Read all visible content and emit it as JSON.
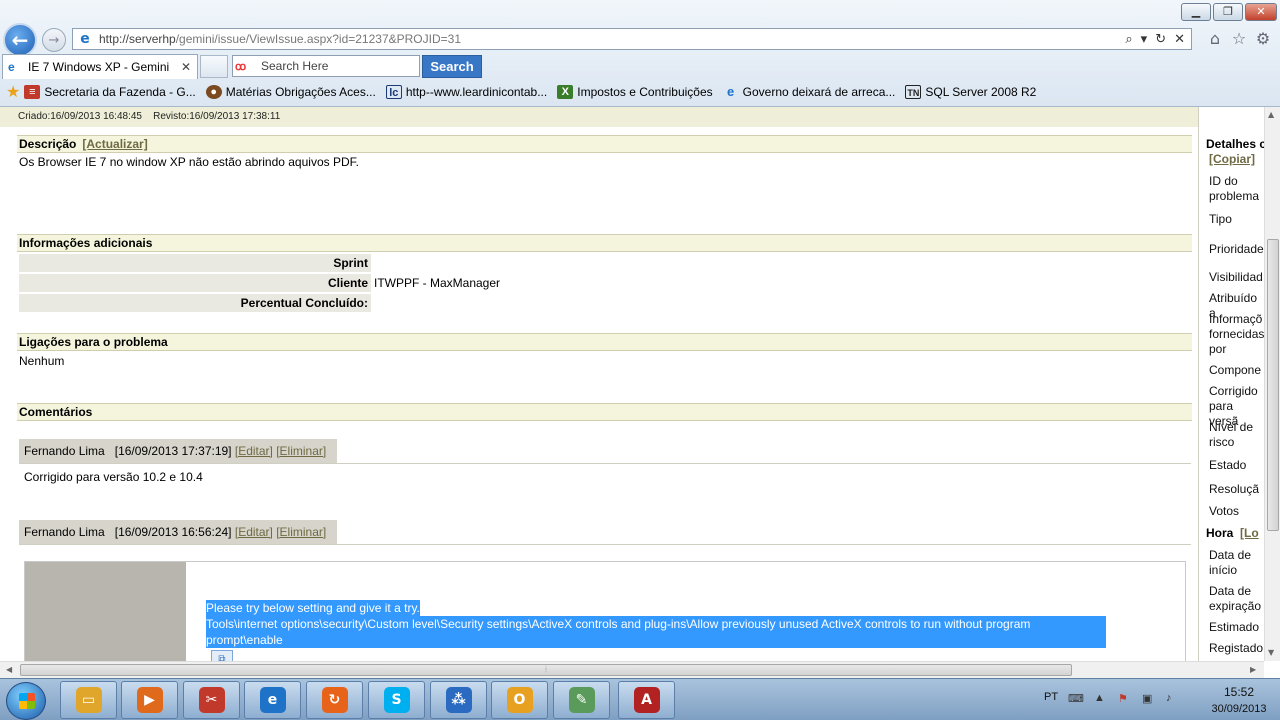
{
  "browser": {
    "url": "http://serverhp/gemini/issue/ViewIssue.aspx?id=21237&PROJID=31",
    "url_host": "http://serverhp",
    "url_path": "/gemini/issue/ViewIssue.aspx?id=21237&PROJID=31",
    "tab_title": "IE 7 Windows XP - Gemini",
    "search_placeholder": "Search Here",
    "search_button": "Search",
    "favorites": [
      {
        "label": "Secretaria da Fazenda - G...",
        "icon": "flag-icon",
        "color": "#c0392b"
      },
      {
        "label": "Matérias Obrigações Aces...",
        "icon": "globe-icon",
        "color": "#7b4a20"
      },
      {
        "label": "http--www.leardinicontab...",
        "icon": "lc-icon",
        "color": "#1a3b78"
      },
      {
        "label": "Impostos e Contribuições",
        "icon": "x-icon",
        "color": "#3a7d2b"
      },
      {
        "label": "Governo deixará de arreca...",
        "icon": "ie-icon",
        "color": "#1e73c8"
      },
      {
        "label": "SQL Server 2008 R2",
        "icon": "tn-icon",
        "color": "#222222"
      }
    ]
  },
  "issue": {
    "created": "Criado:16/09/2013 16:48:45",
    "revised": "Revisto:16/09/2013 17:38:11",
    "description_header": "Descrição",
    "update_link": "[Actualizar]",
    "description_text": "Os Browser IE 7 no window XP não estão abrindo aquivos PDF.",
    "additional_header": "Informações adicionais",
    "fields": [
      {
        "label": "Sprint",
        "value": ""
      },
      {
        "label": "Cliente",
        "value": "ITWPPF - MaxManager"
      },
      {
        "label": "Percentual Concluído:",
        "value": ""
      }
    ],
    "links_header": "Ligações para o problema",
    "links_value": "Nenhum",
    "comments_header": "Comentários",
    "comments": [
      {
        "author": "Fernando Lima",
        "date": "[16/09/2013 17:37:19]",
        "edit": "[Editar]",
        "delete": "[Eliminar]",
        "text": "Corrigido para versão 10.2 e 10.4"
      },
      {
        "author": "Fernando Lima",
        "date": "[16/09/2013 16:56:24]",
        "edit": "[Editar]",
        "delete": "[Eliminar]",
        "line1": "Please try below setting and give it a try.",
        "line2": "Tools\\internet options\\security\\Custom level\\Security settings\\ActiveX controls and plug-ins\\Allow previously unused ActiveX controls to run without program prompt\\enable"
      }
    ]
  },
  "right_panel": {
    "details_header": "Detalhes c",
    "copy_link": "[Copiar]",
    "items": [
      "ID do problema",
      "Tipo",
      "Prioridade",
      "Visibilidad",
      "Atribuído a",
      "Informaçõ fornecidas por",
      "Compone",
      "Corrigido para versã",
      "Nível de risco",
      "Estado",
      "Resoluçã",
      "Votos"
    ],
    "hours_header": "Hora",
    "hours_link": "[Lo",
    "hours_items": [
      "Data de início",
      "Data de expiração",
      "Estimado",
      "Registado"
    ]
  },
  "taskbar": {
    "apps": [
      {
        "name": "explorer",
        "icon": "folder-icon",
        "color": "#e0a52b"
      },
      {
        "name": "media-player",
        "icon": "media-icon",
        "color": "#e06a1b"
      },
      {
        "name": "snipping-tool",
        "icon": "scissors-icon",
        "color": "#c0392b"
      },
      {
        "name": "internet-explorer",
        "icon": "ie-icon",
        "color": "#1e73c8"
      },
      {
        "name": "sync",
        "icon": "sync-icon",
        "color": "#e8631a"
      },
      {
        "name": "skype",
        "icon": "skype-icon",
        "color": "#00aff0"
      },
      {
        "name": "connect",
        "icon": "network-icon",
        "color": "#2a6ac0"
      },
      {
        "name": "outlook",
        "icon": "outlook-icon",
        "color": "#e8a020"
      },
      {
        "name": "notepad",
        "icon": "notepad-icon",
        "color": "#5a9a5a"
      },
      {
        "name": "access",
        "icon": "access-icon",
        "color": "#b22222"
      }
    ],
    "language": "PT",
    "time": "15:52",
    "date": "30/09/2013"
  }
}
